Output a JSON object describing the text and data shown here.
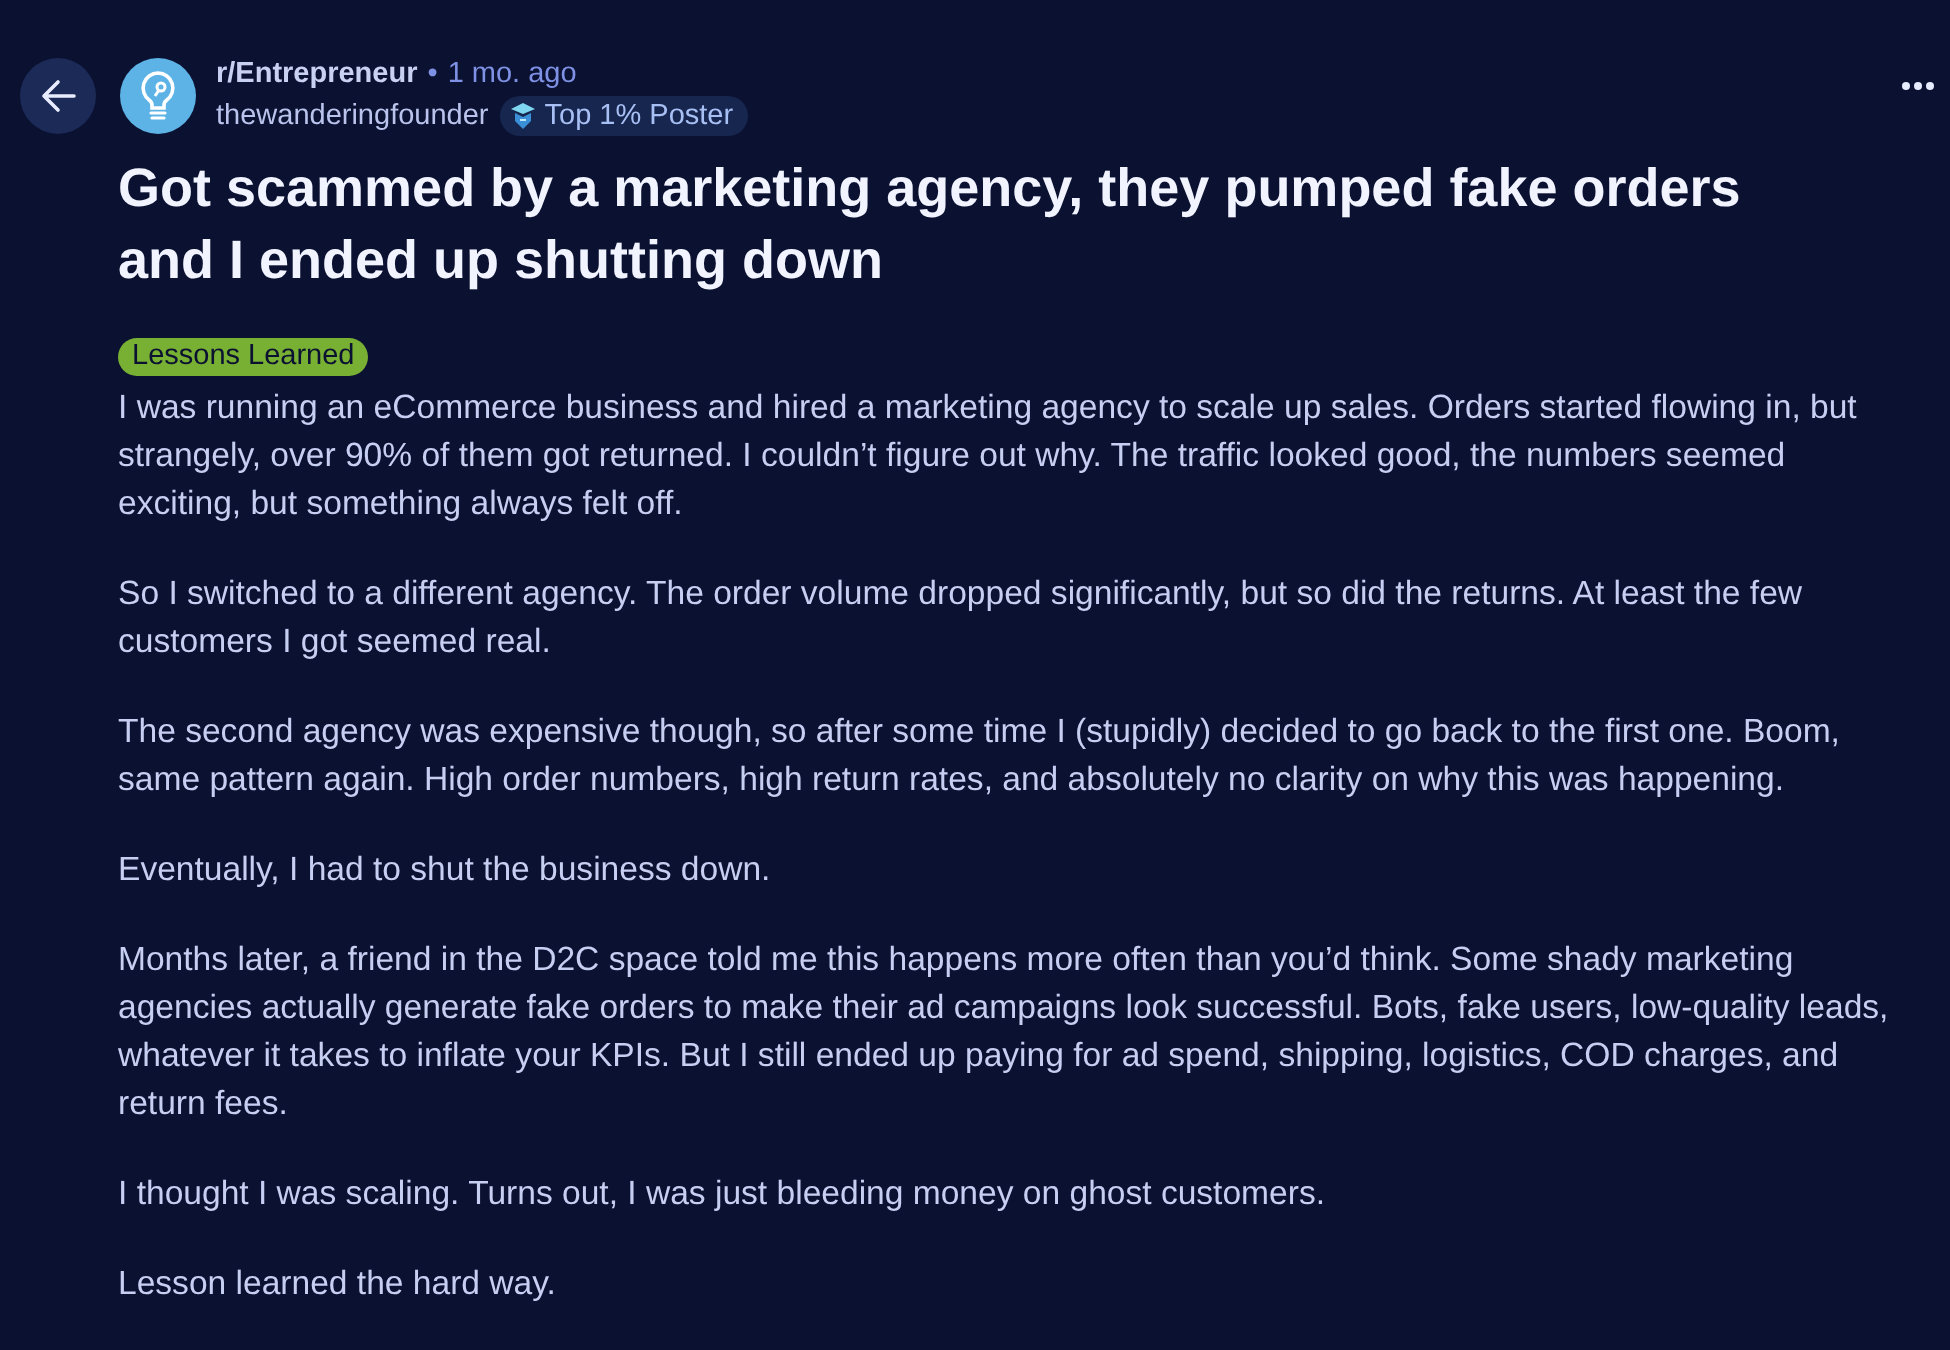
{
  "header": {
    "subreddit": "r/Entrepreneur",
    "separator": "•",
    "time": "1 mo. ago",
    "author": "thewanderingfounder",
    "author_badge": "Top 1% Poster"
  },
  "post": {
    "title": "Got scammed by a marketing agency, they pumped fake orders and I ended up shutting down",
    "flair": "Lessons Learned",
    "paragraphs": [
      "I was running an eCommerce business and hired a marketing agency to scale up sales. Orders started flowing in, but strangely, over 90% of them got returned. I couldn’t figure out why. The traffic looked good, the numbers seemed exciting, but something always felt off.",
      "So I switched to a different agency. The order volume dropped significantly, but so did the returns. At least the few customers I got seemed real.",
      "The second agency was expensive though, so after some time I (stupidly) decided to go back to the first one. Boom, same pattern again. High order numbers, high return rates, and absolutely no clarity on why this was happening.",
      "Eventually, I had to shut the business down.",
      "Months later, a friend in the D2C space told me this happens more often than you’d think. Some shady marketing agencies actually generate fake orders to make their ad campaigns look successful. Bots, fake users, low-quality leads, whatever it takes to inflate your KPIs. But I still ended up paying for ad spend, shipping, logistics, COD charges, and return fees.",
      "I thought I was scaling. Turns out, I was just bleeding money on ghost customers.",
      "Lesson learned the hard way."
    ]
  }
}
